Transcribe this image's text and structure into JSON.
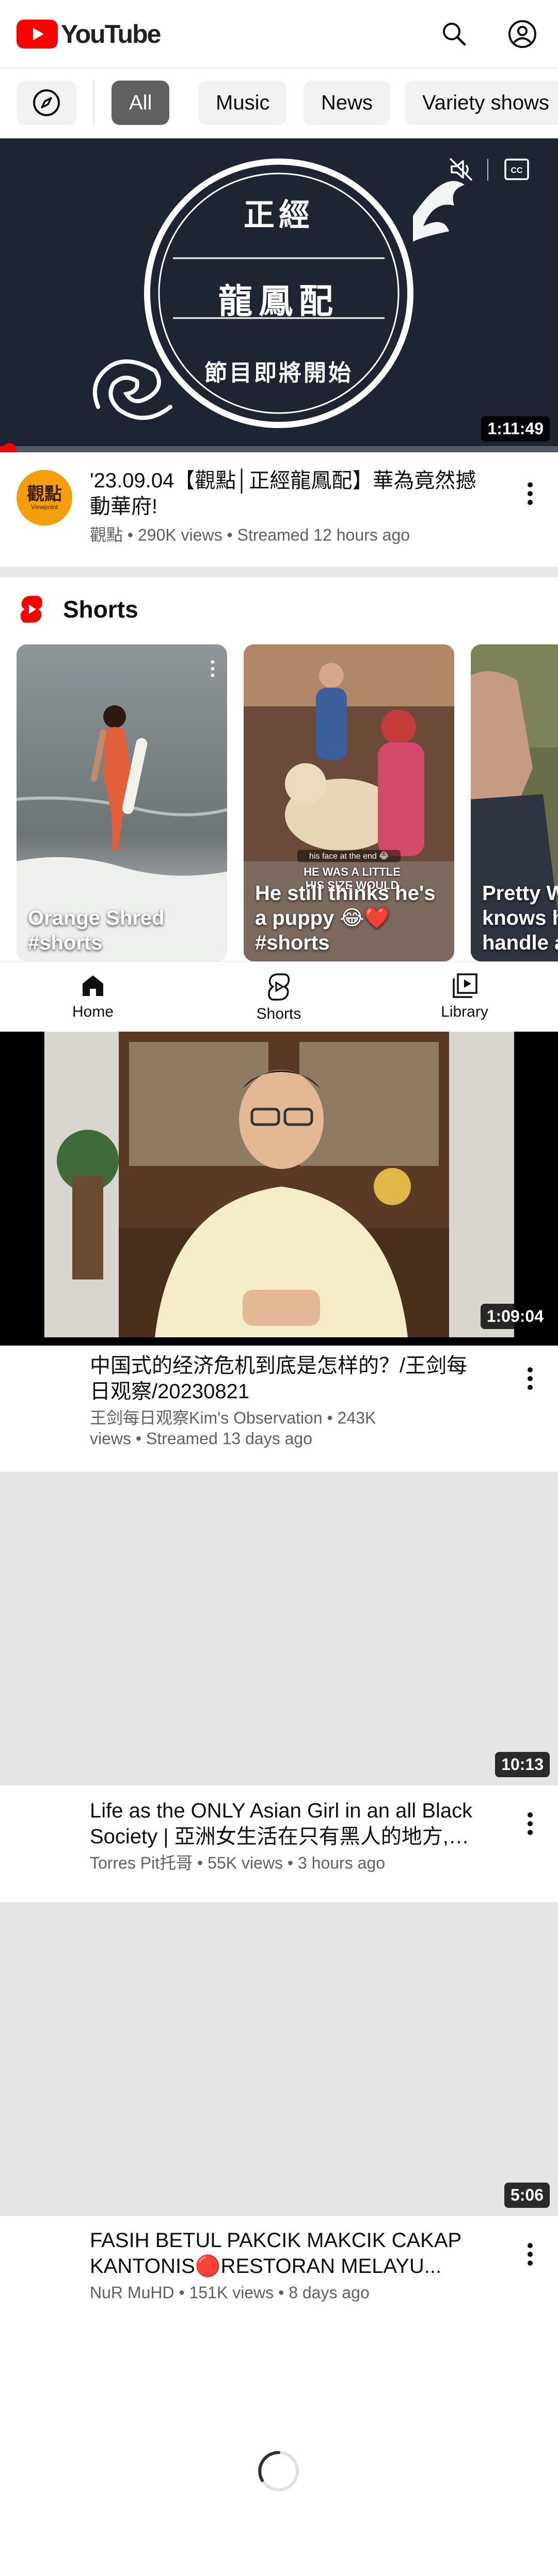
{
  "app": {
    "logo_text": "YouTube",
    "accent_color": "#ff0000"
  },
  "chips": [
    {
      "label": "All",
      "active": true
    },
    {
      "label": "Music",
      "active": false
    },
    {
      "label": "News",
      "active": false
    },
    {
      "label": "Variety shows",
      "active": false
    }
  ],
  "featured": {
    "thumbnail_title_line1": "正經",
    "thumbnail_title_line2": "龍鳳配",
    "thumbnail_subtitle": "節目即將開始",
    "duration": "1:11:49",
    "progress_fraction": 0.01,
    "channel_avatar_text": "觀點",
    "channel_avatar_subtext": "Viewpoint",
    "title": "'23.09.04【觀點│正經龍鳳配】華為竟然撼動華府!",
    "channel": "觀點",
    "views": "290K views",
    "age": "Streamed 12 hours ago"
  },
  "shorts": {
    "heading": "Shorts",
    "items": [
      {
        "title": "Orange Shred #shorts"
      },
      {
        "title": "He still thinks he's a puppy 😂❤️ #shorts",
        "overlay_caption_1": "his face at the end 😂",
        "overlay_caption_2": "HE WAS A LITTLE",
        "overlay_caption_3": "HIS SIZE WOULD"
      },
      {
        "title": "Pretty W knows h handle a"
      }
    ]
  },
  "bottom_nav": [
    {
      "label": "Home",
      "icon": "home-icon",
      "active": true
    },
    {
      "label": "Shorts",
      "icon": "shorts-icon",
      "active": false
    },
    {
      "label": "Library",
      "icon": "library-icon",
      "active": false
    }
  ],
  "videos": [
    {
      "title": "中国式的经济危机到底是怎样的？/王剑每日观察/20230821",
      "channel": "王剑每日观察Kim's Observation",
      "views": "243K views",
      "age": "Streamed 13 days ago",
      "duration": "1:09:04"
    },
    {
      "title": "Life as the ONLY Asian Girl in an all Black Society | 亞洲女生活在只有黑人的地方, 村...",
      "channel": "Torres Pit托哥",
      "views": "55K views",
      "age": "3 hours ago",
      "duration": "10:13"
    },
    {
      "title": "FASIH BETUL PAKCIK MAKCIK CAKAP KANTONIS🔴RESTORAN MELAYU...",
      "channel": "NuR MuHD",
      "views": "151K views",
      "age": "8 days ago",
      "duration": "5:06"
    }
  ]
}
